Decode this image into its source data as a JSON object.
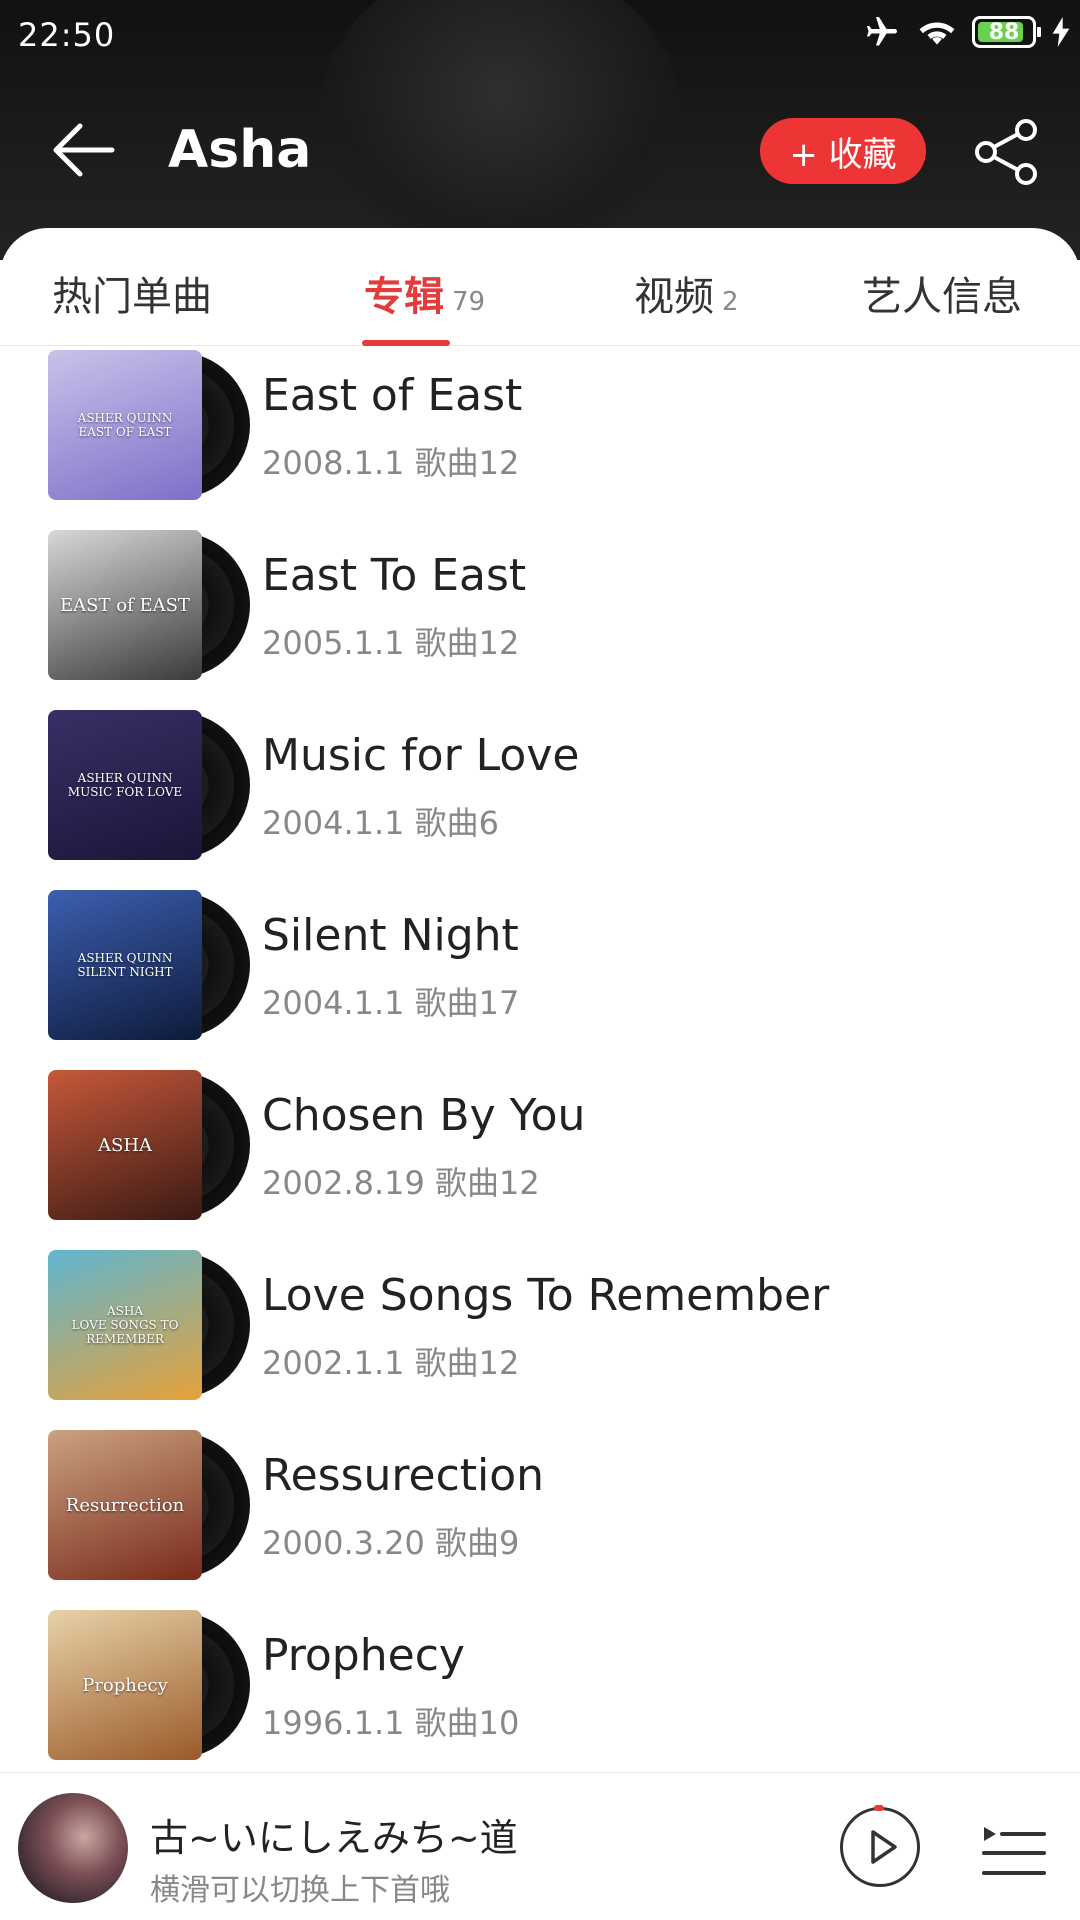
{
  "status_bar": {
    "time": "22:50",
    "battery": "88"
  },
  "header": {
    "title": "Asha",
    "favorite_label": "+ 收藏"
  },
  "tabs": [
    {
      "label": "热门单曲",
      "count": ""
    },
    {
      "label": "专辑",
      "count": "79",
      "active": true
    },
    {
      "label": "视频",
      "count": "2"
    },
    {
      "label": "艺人信息",
      "count": ""
    }
  ],
  "albums": [
    {
      "title": "East of East",
      "meta": "2008.1.1 歌曲12",
      "cover_text": "ASHER QUINN\nEAST OF EAST",
      "cover_colors": [
        "#c9c2ea",
        "#7e6fc9"
      ]
    },
    {
      "title": "East To East",
      "meta": "2005.1.1 歌曲12",
      "cover_text": "EAST of EAST",
      "cover_colors": [
        "#d8d8d8",
        "#3a3a3a"
      ]
    },
    {
      "title": "Music for Love",
      "meta": "2004.1.1 歌曲6",
      "cover_text": "ASHER QUINN\nMUSIC FOR LOVE",
      "cover_colors": [
        "#3a2f66",
        "#1a1538"
      ]
    },
    {
      "title": "Silent Night",
      "meta": "2004.1.1 歌曲17",
      "cover_text": "ASHER QUINN\nSILENT NIGHT",
      "cover_colors": [
        "#3c5fb0",
        "#0e1a3a"
      ]
    },
    {
      "title": "Chosen By You",
      "meta": "2002.8.19 歌曲12",
      "cover_text": "ASHA",
      "cover_colors": [
        "#c6583a",
        "#3a1a14"
      ]
    },
    {
      "title": "Love Songs To Remember",
      "meta": "2002.1.1 歌曲12",
      "cover_text": "ASHA\nLOVE SONGS TO REMEMBER",
      "cover_colors": [
        "#5fb6d0",
        "#e6a13a"
      ]
    },
    {
      "title": "Ressurection",
      "meta": "2000.3.20 歌曲9",
      "cover_text": "Resurrection",
      "cover_colors": [
        "#caa280",
        "#7a2a1a"
      ]
    },
    {
      "title": "Prophecy",
      "meta": "1996.1.1 歌曲10",
      "cover_text": "Prophecy",
      "cover_colors": [
        "#e8d2a8",
        "#9a5a2a"
      ]
    }
  ],
  "player": {
    "title": "古~いにしえみち~道",
    "subtitle": "横滑可以切换上下首哦"
  },
  "colors": {
    "accent": "#e63b3b",
    "header_bg": "#1a1a1a"
  }
}
